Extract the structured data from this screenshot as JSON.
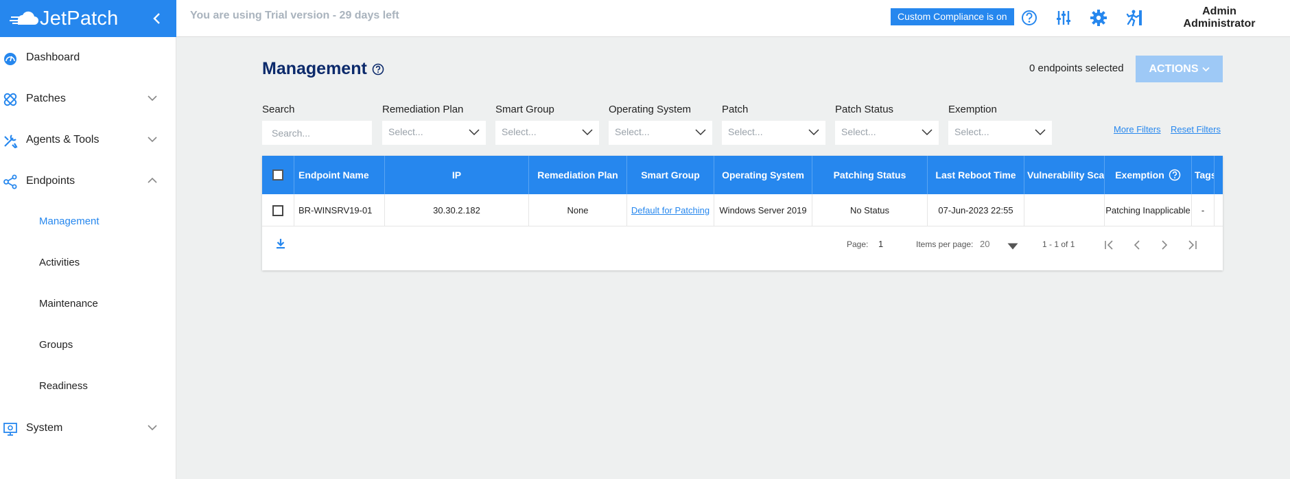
{
  "brand": {
    "name": "JetPatch"
  },
  "header": {
    "trial_text": "You are using Trial version - 29 days left",
    "compliance_badge": "Custom Compliance is on",
    "user_line1": "Admin",
    "user_line2": "Administrator"
  },
  "sidebar": {
    "items": [
      {
        "label": "Dashboard"
      },
      {
        "label": "Patches"
      },
      {
        "label": "Agents & Tools"
      },
      {
        "label": "Endpoints"
      },
      {
        "label": "System"
      }
    ],
    "subitems": [
      {
        "label": "Management"
      },
      {
        "label": "Activities"
      },
      {
        "label": "Maintenance"
      },
      {
        "label": "Groups"
      },
      {
        "label": "Readiness"
      }
    ]
  },
  "main": {
    "title": "Management",
    "selected_count": "0 endpoints selected",
    "actions_label": "ACTIONS",
    "filters": {
      "search_label": "Search",
      "search_placeholder": "Search...",
      "selects": [
        {
          "label": "Remediation Plan",
          "placeholder": "Select..."
        },
        {
          "label": "Smart Group",
          "placeholder": "Select..."
        },
        {
          "label": "Operating System",
          "placeholder": "Select..."
        },
        {
          "label": "Patch",
          "placeholder": "Select..."
        },
        {
          "label": "Patch Status",
          "placeholder": "Select..."
        },
        {
          "label": "Exemption",
          "placeholder": "Select..."
        }
      ],
      "more_filters": "More Filters",
      "reset_filters": "Reset Filters"
    },
    "table": {
      "columns": [
        "Endpoint Name",
        "IP",
        "Remediation Plan",
        "Smart Group",
        "Operating System",
        "Patching Status",
        "Last Reboot Time",
        "Vulnerability Scan",
        "Exemption",
        "Tags"
      ],
      "rows": [
        {
          "endpoint_name": "BR-WINSRV19-01",
          "ip": "30.30.2.182",
          "remediation_plan": "None",
          "smart_group": "Default for Patching",
          "operating_system": "Windows Server 2019",
          "patching_status": "No Status",
          "last_reboot": "07-Jun-2023 22:55",
          "vulnerability_scan": "",
          "exemption": "Patching Inapplicable",
          "tags": "-"
        }
      ]
    },
    "pager": {
      "page_label": "Page:",
      "page_value": "1",
      "items_label": "Items per page:",
      "items_value": "20",
      "range": "1 - 1 of 1"
    }
  },
  "colors": {
    "primary": "#2687ee",
    "title": "#0c2a6b",
    "trial_text": "#a9b3bd",
    "actions_disabled": "#9ec9f6"
  }
}
